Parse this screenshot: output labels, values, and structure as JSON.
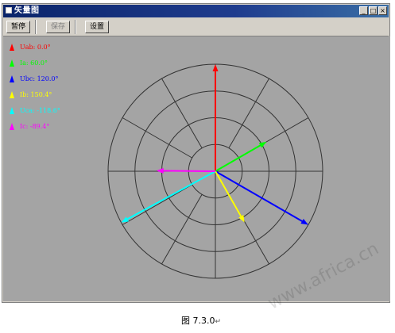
{
  "window": {
    "title": "矢量图",
    "buttons": [
      "_",
      "□",
      "×"
    ]
  },
  "toolbar": {
    "pause_label": "暂停",
    "save_label": "保存",
    "settings_label": "设置"
  },
  "legend": [
    {
      "text": "Uab: 0.0°",
      "color": "#ff0000"
    },
    {
      "text": "Ia: 60.0°",
      "color": "#00ff00"
    },
    {
      "text": "Ubc: 120.0°",
      "color": "#0000ff"
    },
    {
      "text": "Ib: 150.4°",
      "color": "#ffff00"
    },
    {
      "text": "Uca: -118.6°",
      "color": "#00ffff"
    },
    {
      "text": "Ic: -89.4°",
      "color": "#ff00ff"
    }
  ],
  "vectors": [
    {
      "name": "Uab",
      "angle_deg": 0.0,
      "magnitude": 1.0,
      "color": "#ff0000"
    },
    {
      "name": "Ia",
      "angle_deg": 60.0,
      "magnitude": 0.55,
      "color": "#00ff00"
    },
    {
      "name": "Ubc",
      "angle_deg": 120.0,
      "magnitude": 1.0,
      "color": "#0000ff"
    },
    {
      "name": "Ib",
      "angle_deg": 150.4,
      "magnitude": 0.55,
      "color": "#ffff00"
    },
    {
      "name": "Uca",
      "angle_deg": -118.6,
      "magnitude": 1.0,
      "color": "#00ffff"
    },
    {
      "name": "Ic",
      "angle_deg": -89.4,
      "magnitude": 0.55,
      "color": "#ff00ff"
    }
  ],
  "polar_grid": {
    "rings": 4,
    "spokes": 12
  },
  "caption": {
    "text": "图 7.3.0",
    "return_mark": "↵"
  },
  "watermark": "www.africa.cn"
}
